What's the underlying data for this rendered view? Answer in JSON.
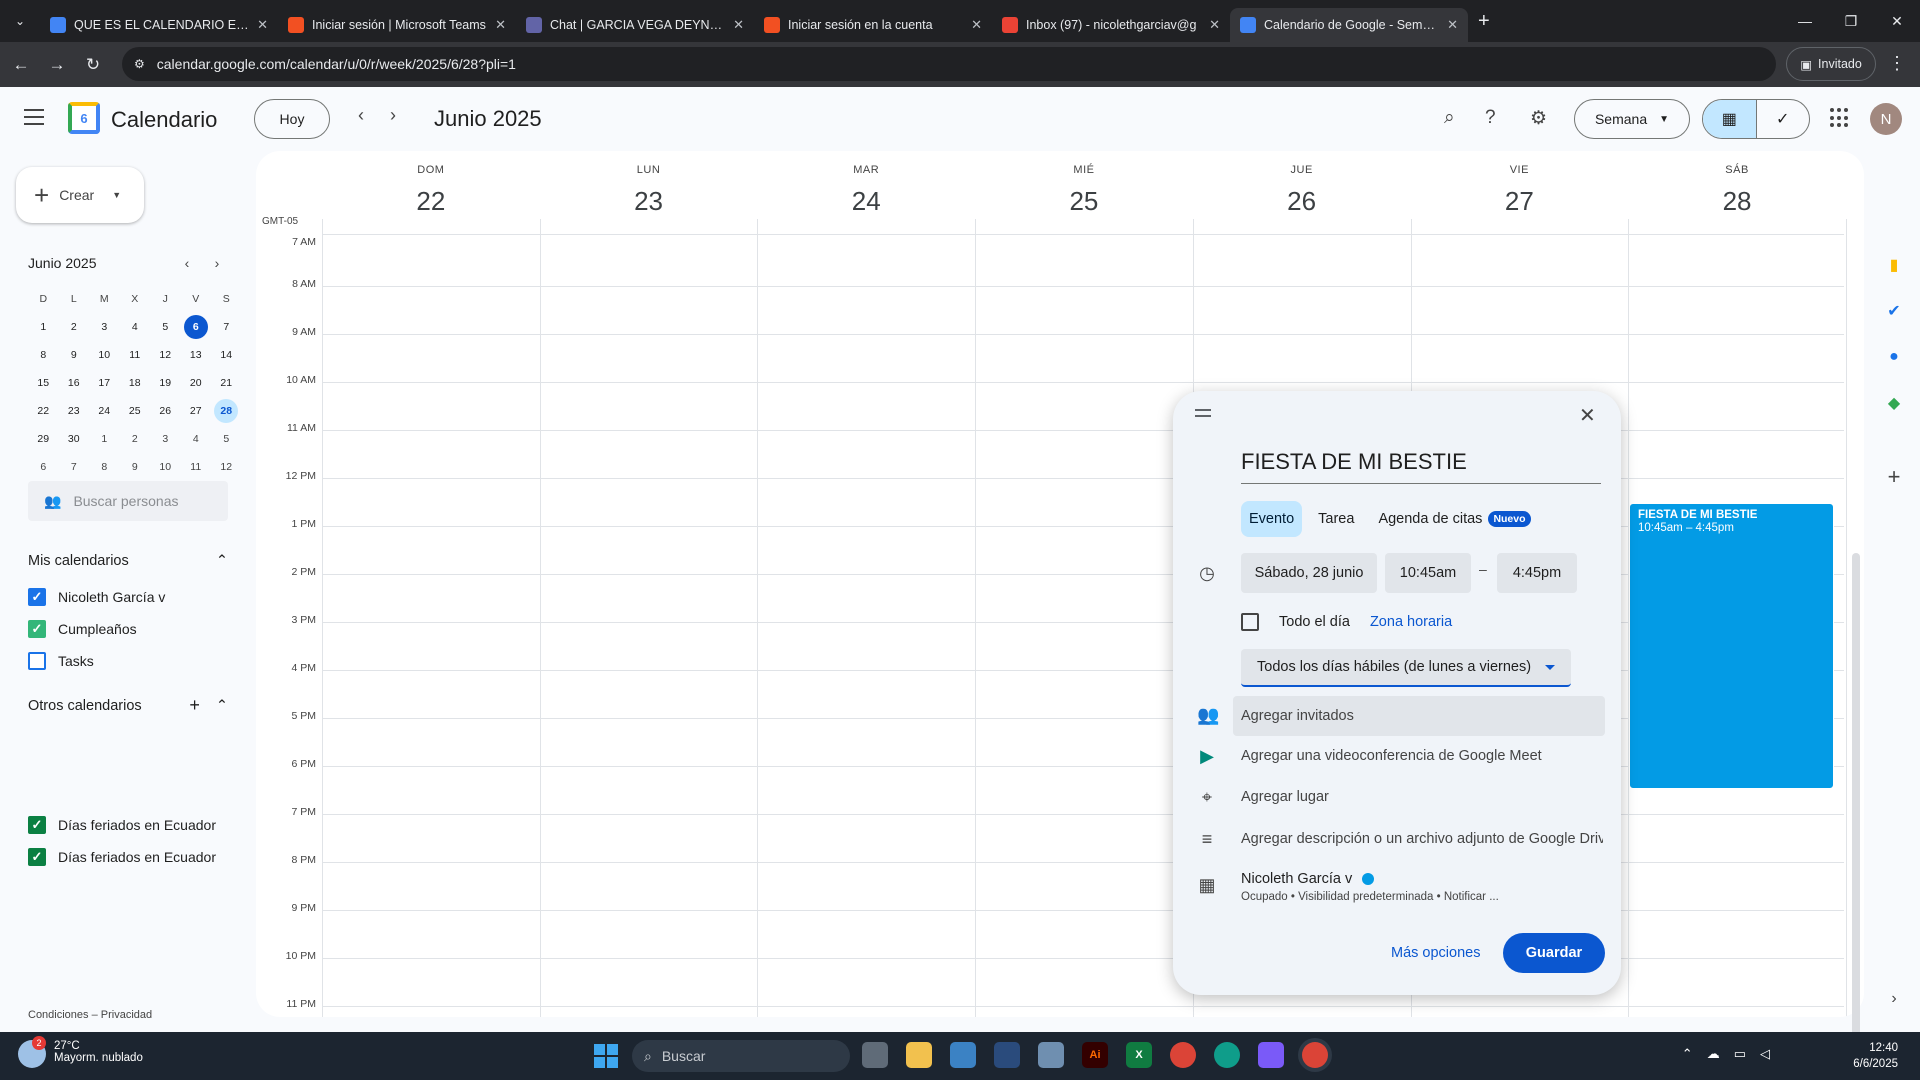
{
  "browser": {
    "tabs": [
      {
        "label": "QUE ES EL CALENDARIO EN GM",
        "fav_color": "#4285f4",
        "active": false
      },
      {
        "label": "Iniciar sesión | Microsoft Teams",
        "fav_color": "#f25022",
        "active": false
      },
      {
        "label": "Chat | GARCIA VEGA DEYNA NI",
        "fav_color": "#6264a7",
        "active": false
      },
      {
        "label": "Iniciar sesión en la cuenta",
        "fav_color": "#f25022",
        "active": false
      },
      {
        "label": "Inbox (97) - nicolethgarciav@g",
        "fav_color": "#ea4335",
        "active": false
      },
      {
        "label": "Calendario de Google - Semana",
        "fav_color": "#4285f4",
        "active": true
      }
    ],
    "url": "calendar.google.com/calendar/u/0/r/week/2025/6/28?pli=1",
    "profile_label": "Invitado"
  },
  "header": {
    "app_title": "Calendario",
    "logo_day": "6",
    "today_label": "Hoy",
    "period_title": "Junio 2025",
    "view_label": "Semana",
    "avatar_letter": "N"
  },
  "sidebar": {
    "create_label": "Crear",
    "mini_cal": {
      "title": "Junio 2025",
      "dow": [
        "D",
        "L",
        "M",
        "X",
        "J",
        "V",
        "S"
      ],
      "weeks": [
        [
          "1",
          "2",
          "3",
          "4",
          "5",
          "6",
          "7"
        ],
        [
          "8",
          "9",
          "10",
          "11",
          "12",
          "13",
          "14"
        ],
        [
          "15",
          "16",
          "17",
          "18",
          "19",
          "20",
          "21"
        ],
        [
          "22",
          "23",
          "24",
          "25",
          "26",
          "27",
          "28"
        ],
        [
          "29",
          "30",
          "1",
          "2",
          "3",
          "4",
          "5"
        ],
        [
          "6",
          "7",
          "8",
          "9",
          "10",
          "11",
          "12"
        ]
      ],
      "today": "6",
      "selected": "28"
    },
    "search_people_placeholder": "Buscar personas",
    "my_calendars_title": "Mis calendarios",
    "my_calendars": [
      {
        "label": "Nicoleth García v",
        "color": "#1a73e8",
        "checked": true
      },
      {
        "label": "Cumpleaños",
        "color": "#33b679",
        "checked": true
      },
      {
        "label": "Tasks",
        "color": "#1a73e8",
        "checked": false
      }
    ],
    "other_calendars_title": "Otros calendarios",
    "other_calendars": [
      {
        "label": "Días feriados en Ecuador",
        "color": "#0b8043",
        "checked": true
      },
      {
        "label": "Días feriados en Ecuador",
        "color": "#0b8043",
        "checked": true
      }
    ],
    "footer": "Condiciones – Privacidad"
  },
  "week": {
    "timezone": "GMT-05",
    "days": [
      {
        "name": "DOM",
        "num": "22"
      },
      {
        "name": "LUN",
        "num": "23"
      },
      {
        "name": "MAR",
        "num": "24"
      },
      {
        "name": "MIÉ",
        "num": "25"
      },
      {
        "name": "JUE",
        "num": "26"
      },
      {
        "name": "VIE",
        "num": "27"
      },
      {
        "name": "SÁB",
        "num": "28"
      }
    ],
    "hours": [
      "7 AM",
      "8 AM",
      "9 AM",
      "10 AM",
      "11 AM",
      "12 PM",
      "1 PM",
      "2 PM",
      "3 PM",
      "4 PM",
      "5 PM",
      "6 PM",
      "7 PM",
      "8 PM",
      "9 PM",
      "10 PM",
      "11 PM"
    ]
  },
  "event": {
    "title": "FIESTA DE MI BESTIE",
    "time": "10:45am – 4:45pm",
    "color": "#039be5"
  },
  "dialog": {
    "title": "FIESTA DE MI BESTIE",
    "tabs": [
      "Evento",
      "Tarea",
      "Agenda de citas"
    ],
    "new_badge": "Nuevo",
    "date": "Sábado, 28 junio",
    "start": "10:45am",
    "dash": "–",
    "end": "4:45pm",
    "all_day": "Todo el día",
    "timezone_link": "Zona horaria",
    "recurrence": "Todos los días hábiles (de lunes a viernes)",
    "add_guests": "Agregar invitados",
    "add_meet": "Agregar una videoconferencia de Google Meet",
    "add_location": "Agregar lugar",
    "add_description": "Agregar descripción o un archivo adjunto de Google Drive",
    "owner": "Nicoleth García v",
    "owner_sub": "Ocupado • Visibilidad predeterminada • Notificar ...",
    "more_options": "Más opciones",
    "save": "Guardar"
  },
  "taskbar": {
    "weather_temp": "27°C",
    "weather_desc": "Mayorm. nublado",
    "weather_badge": "2",
    "search_label": "Buscar",
    "time": "12:40",
    "date": "6/6/2025"
  }
}
